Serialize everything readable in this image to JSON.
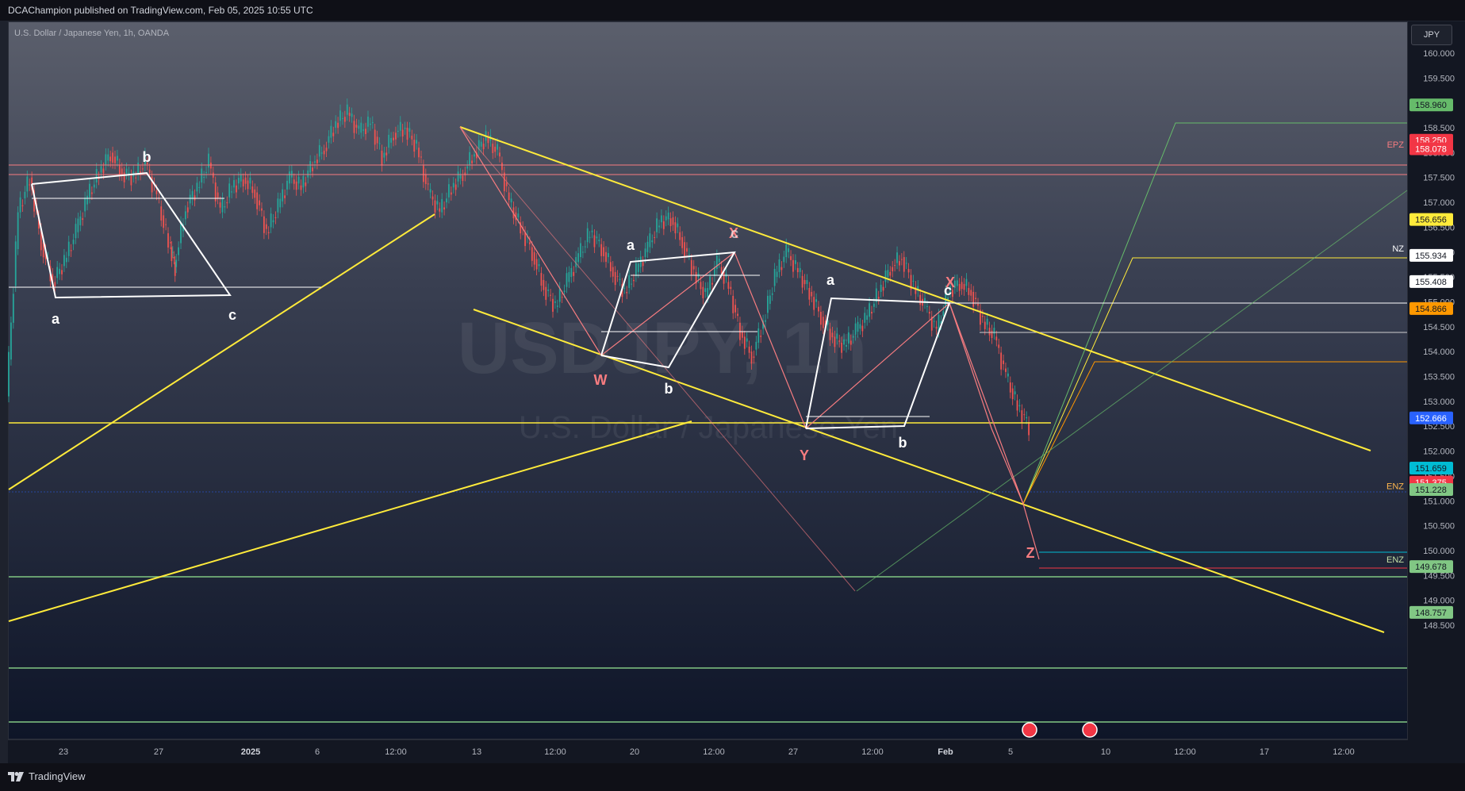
{
  "header": {
    "published": "DCAChampion published on TradingView.com, Feb 05, 2025 10:55 UTC"
  },
  "footer": {
    "brand": "TradingView"
  },
  "chart_data": {
    "type": "line",
    "title": "U.S. Dollar / Japanese Yen, 1h, OANDA",
    "watermark_symbol": "USDJPY, 1h",
    "watermark_name": "U.S. Dollar / Japanese Yen",
    "currency": "JPY",
    "ylim": [
      148.5,
      160.0
    ],
    "y_ticks": [
      "160.000",
      "159.500",
      "158.500",
      "158.000",
      "157.500",
      "157.000",
      "156.500",
      "156.000",
      "155.500",
      "155.000",
      "154.500",
      "154.000",
      "153.500",
      "153.000",
      "152.500",
      "152.000",
      "151.500",
      "151.000",
      "150.500",
      "150.000",
      "149.500",
      "149.000",
      "148.500"
    ],
    "x_ticks": [
      {
        "label": "23",
        "bold": false
      },
      {
        "label": "27",
        "bold": false
      },
      {
        "label": "2025",
        "bold": true
      },
      {
        "label": "6",
        "bold": false
      },
      {
        "label": "12:00",
        "bold": false
      },
      {
        "label": "13",
        "bold": false
      },
      {
        "label": "12:00",
        "bold": false
      },
      {
        "label": "20",
        "bold": false
      },
      {
        "label": "12:00",
        "bold": false
      },
      {
        "label": "27",
        "bold": false
      },
      {
        "label": "12:00",
        "bold": false
      },
      {
        "label": "Feb",
        "bold": true
      },
      {
        "label": "5",
        "bold": false
      },
      {
        "label": "10",
        "bold": false
      },
      {
        "label": "12:00",
        "bold": false
      },
      {
        "label": "17",
        "bold": false
      },
      {
        "label": "12:00",
        "bold": false
      }
    ],
    "price_markers": [
      {
        "value": "158.960",
        "price": 158.96,
        "color": "#66bb6a",
        "text_color": "#131722"
      },
      {
        "value": "158.250",
        "price": 158.25,
        "color": "#f23645",
        "text_color": "#ffffff"
      },
      {
        "value": "158.078",
        "price": 158.078,
        "color": "#f23645",
        "text_color": "#ffffff"
      },
      {
        "value": "156.656",
        "price": 156.656,
        "color": "#ffeb3b",
        "text_color": "#131722"
      },
      {
        "value": "155.934",
        "price": 155.934,
        "color": "#ffffff",
        "text_color": "#131722"
      },
      {
        "value": "155.408",
        "price": 155.408,
        "color": "#ffffff",
        "text_color": "#131722"
      },
      {
        "value": "154.866",
        "price": 154.866,
        "color": "#ff9800",
        "text_color": "#131722"
      },
      {
        "value": "152.666",
        "price": 152.666,
        "color": "#2962ff",
        "text_color": "#ffffff"
      },
      {
        "value": "151.659",
        "price": 151.659,
        "color": "#00bcd4",
        "text_color": "#131722"
      },
      {
        "value": "151.375",
        "price": 151.375,
        "color": "#f23645",
        "text_color": "#ffffff"
      },
      {
        "value": "151.228",
        "price": 151.228,
        "color": "#81c784",
        "text_color": "#131722"
      },
      {
        "value": "149.678",
        "price": 149.678,
        "color": "#81c784",
        "text_color": "#131722"
      },
      {
        "value": "148.757",
        "price": 148.757,
        "color": "#81c784",
        "text_color": "#131722"
      }
    ],
    "zone_labels": [
      {
        "text": "EPZ",
        "price": 158.165,
        "color": "#f77c80"
      },
      {
        "text": "NZ",
        "price": 156.08,
        "color": "#ffffff"
      },
      {
        "text": "ENZ",
        "price": 151.3,
        "color": "#ffb74d"
      },
      {
        "text": "ENZ",
        "price": 149.82,
        "color": "#c5e1a5"
      }
    ],
    "wave_labels": [
      {
        "text": "W",
        "color": "#f77c80"
      },
      {
        "text": "X",
        "color": "#f77c80"
      },
      {
        "text": "Y",
        "color": "#f77c80"
      },
      {
        "text": "X",
        "color": "#f77c80"
      },
      {
        "text": "Z",
        "color": "#f77c80"
      },
      {
        "text": "a",
        "color": "#ffffff"
      },
      {
        "text": "b",
        "color": "#ffffff"
      },
      {
        "text": "c",
        "color": "#ffffff"
      },
      {
        "text": "a",
        "color": "#ffffff"
      },
      {
        "text": "b",
        "color": "#ffffff"
      },
      {
        "text": "c",
        "color": "#ffffff"
      },
      {
        "text": "a",
        "color": "#ffffff"
      },
      {
        "text": "b",
        "color": "#ffffff"
      },
      {
        "text": "c",
        "color": "#ffffff"
      }
    ],
    "price_series_approx": [
      [
        0,
        153.1
      ],
      [
        4,
        156.8
      ],
      [
        8,
        157.5
      ],
      [
        12,
        156.2
      ],
      [
        16,
        155.4
      ],
      [
        20,
        155.8
      ],
      [
        24,
        156.4
      ],
      [
        28,
        157.1
      ],
      [
        32,
        157.6
      ],
      [
        36,
        158.0
      ],
      [
        40,
        157.6
      ],
      [
        44,
        157.5
      ],
      [
        48,
        157.8
      ],
      [
        52,
        157.1
      ],
      [
        56,
        156.2
      ],
      [
        58,
        155.7
      ],
      [
        62,
        156.9
      ],
      [
        66,
        157.3
      ],
      [
        70,
        157.8
      ],
      [
        74,
        156.8
      ],
      [
        78,
        157.3
      ],
      [
        82,
        157.5
      ],
      [
        86,
        157.2
      ],
      [
        90,
        156.4
      ],
      [
        94,
        156.9
      ],
      [
        98,
        157.5
      ],
      [
        102,
        157.3
      ],
      [
        106,
        157.8
      ],
      [
        110,
        158.1
      ],
      [
        114,
        158.6
      ],
      [
        118,
        158.8
      ],
      [
        122,
        158.4
      ],
      [
        126,
        158.6
      ],
      [
        130,
        157.9
      ],
      [
        134,
        158.4
      ],
      [
        138,
        158.5
      ],
      [
        142,
        158.1
      ],
      [
        146,
        157.2
      ],
      [
        150,
        156.8
      ],
      [
        154,
        157.3
      ],
      [
        158,
        157.6
      ],
      [
        162,
        158.0
      ],
      [
        166,
        158.3
      ],
      [
        170,
        158.0
      ],
      [
        174,
        157.0
      ],
      [
        178,
        156.5
      ],
      [
        182,
        156.0
      ],
      [
        186,
        155.3
      ],
      [
        190,
        154.9
      ],
      [
        194,
        155.4
      ],
      [
        198,
        155.9
      ],
      [
        202,
        156.4
      ],
      [
        206,
        156.1
      ],
      [
        210,
        155.6
      ],
      [
        214,
        155.2
      ],
      [
        218,
        155.6
      ],
      [
        222,
        156.1
      ],
      [
        226,
        156.6
      ],
      [
        230,
        156.7
      ],
      [
        234,
        156.2
      ],
      [
        238,
        155.6
      ],
      [
        242,
        155.1
      ],
      [
        246,
        155.8
      ],
      [
        250,
        155.3
      ],
      [
        254,
        154.4
      ],
      [
        258,
        153.9
      ],
      [
        262,
        154.6
      ],
      [
        266,
        155.5
      ],
      [
        270,
        156.0
      ],
      [
        274,
        155.6
      ],
      [
        278,
        155.2
      ],
      [
        282,
        154.7
      ],
      [
        286,
        154.3
      ],
      [
        290,
        154.1
      ],
      [
        294,
        154.4
      ],
      [
        298,
        154.7
      ],
      [
        302,
        155.2
      ],
      [
        306,
        155.7
      ],
      [
        310,
        155.9
      ],
      [
        314,
        155.3
      ],
      [
        318,
        154.9
      ],
      [
        322,
        154.4
      ],
      [
        326,
        155.2
      ],
      [
        330,
        155.4
      ],
      [
        334,
        155.2
      ],
      [
        338,
        154.6
      ],
      [
        342,
        154.3
      ],
      [
        346,
        153.5
      ],
      [
        350,
        152.9
      ],
      [
        354,
        152.5
      ]
    ]
  }
}
